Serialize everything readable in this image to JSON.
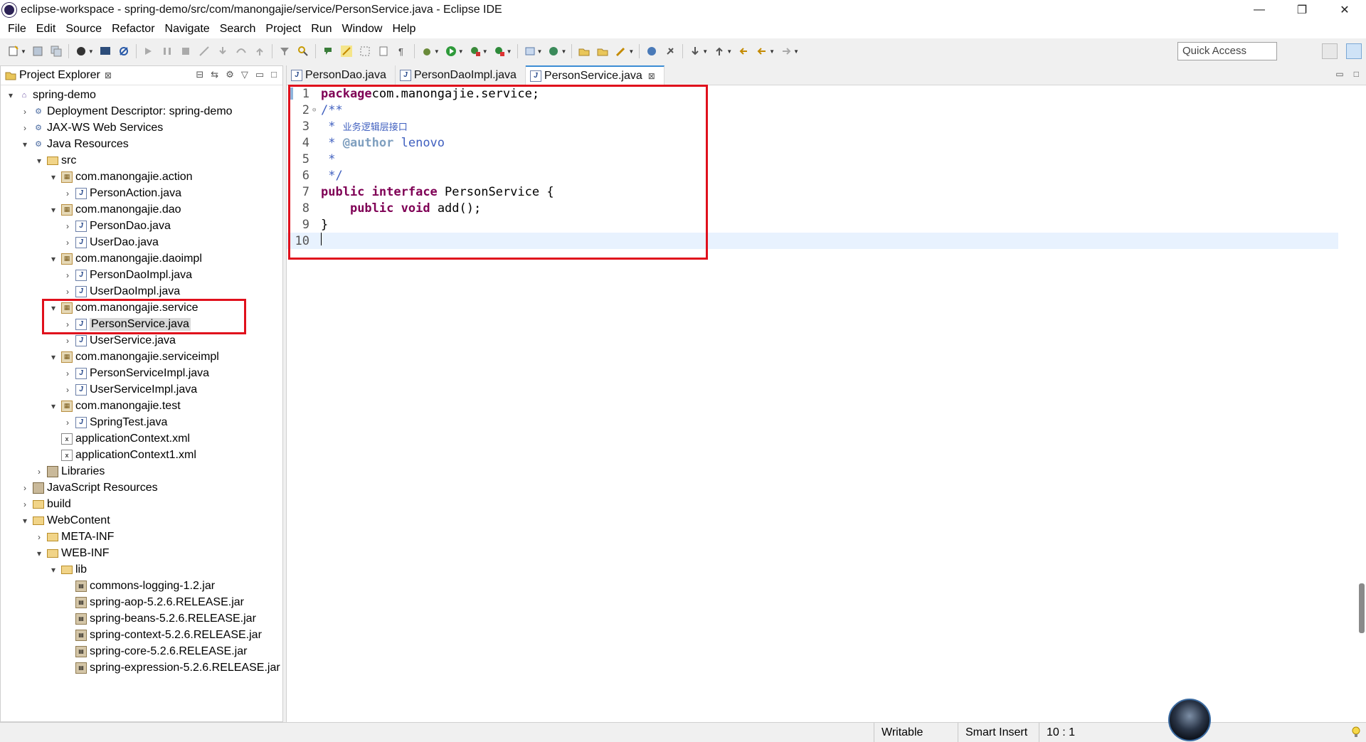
{
  "window": {
    "title": "eclipse-workspace - spring-demo/src/com/manongajie/service/PersonService.java - Eclipse IDE",
    "minimize": "—",
    "restore": "❐",
    "close": "✕"
  },
  "menu": [
    "File",
    "Edit",
    "Source",
    "Refactor",
    "Navigate",
    "Search",
    "Project",
    "Run",
    "Window",
    "Help"
  ],
  "toolbar": {
    "quick_access": "Quick Access"
  },
  "explorer": {
    "title": "Project Explorer",
    "close": "⊠",
    "tree": [
      {
        "label": "spring-demo",
        "depth": 0,
        "twisty": "▾",
        "icon": "project"
      },
      {
        "label": "Deployment Descriptor: spring-demo",
        "depth": 1,
        "twisty": "›",
        "icon": "gear"
      },
      {
        "label": "JAX-WS Web Services",
        "depth": 1,
        "twisty": "›",
        "icon": "gear"
      },
      {
        "label": "Java Resources",
        "depth": 1,
        "twisty": "▾",
        "icon": "gear"
      },
      {
        "label": "src",
        "depth": 2,
        "twisty": "▾",
        "icon": "folder"
      },
      {
        "label": "com.manongajie.action",
        "depth": 3,
        "twisty": "▾",
        "icon": "pkg"
      },
      {
        "label": "PersonAction.java",
        "depth": 4,
        "twisty": "›",
        "icon": "java"
      },
      {
        "label": "com.manongajie.dao",
        "depth": 3,
        "twisty": "▾",
        "icon": "pkg"
      },
      {
        "label": "PersonDao.java",
        "depth": 4,
        "twisty": "›",
        "icon": "java"
      },
      {
        "label": "UserDao.java",
        "depth": 4,
        "twisty": "›",
        "icon": "java"
      },
      {
        "label": "com.manongajie.daoimpl",
        "depth": 3,
        "twisty": "▾",
        "icon": "pkg"
      },
      {
        "label": "PersonDaoImpl.java",
        "depth": 4,
        "twisty": "›",
        "icon": "java"
      },
      {
        "label": "UserDaoImpl.java",
        "depth": 4,
        "twisty": "›",
        "icon": "java"
      },
      {
        "label": "com.manongajie.service",
        "depth": 3,
        "twisty": "▾",
        "icon": "pkg"
      },
      {
        "label": "PersonService.java",
        "depth": 4,
        "twisty": "›",
        "icon": "java",
        "selected": true
      },
      {
        "label": "UserService.java",
        "depth": 4,
        "twisty": "›",
        "icon": "java"
      },
      {
        "label": "com.manongajie.serviceimpl",
        "depth": 3,
        "twisty": "▾",
        "icon": "pkg"
      },
      {
        "label": "PersonServiceImpl.java",
        "depth": 4,
        "twisty": "›",
        "icon": "java"
      },
      {
        "label": "UserServiceImpl.java",
        "depth": 4,
        "twisty": "›",
        "icon": "java"
      },
      {
        "label": "com.manongajie.test",
        "depth": 3,
        "twisty": "▾",
        "icon": "pkg"
      },
      {
        "label": "SpringTest.java",
        "depth": 4,
        "twisty": "›",
        "icon": "java"
      },
      {
        "label": "applicationContext.xml",
        "depth": 3,
        "twisty": "",
        "icon": "xml"
      },
      {
        "label": "applicationContext1.xml",
        "depth": 3,
        "twisty": "",
        "icon": "xml"
      },
      {
        "label": "Libraries",
        "depth": 2,
        "twisty": "›",
        "icon": "lib"
      },
      {
        "label": "JavaScript Resources",
        "depth": 1,
        "twisty": "›",
        "icon": "lib"
      },
      {
        "label": "build",
        "depth": 1,
        "twisty": "›",
        "icon": "folder"
      },
      {
        "label": "WebContent",
        "depth": 1,
        "twisty": "▾",
        "icon": "folder"
      },
      {
        "label": "META-INF",
        "depth": 2,
        "twisty": "›",
        "icon": "folder"
      },
      {
        "label": "WEB-INF",
        "depth": 2,
        "twisty": "▾",
        "icon": "folder"
      },
      {
        "label": "lib",
        "depth": 3,
        "twisty": "▾",
        "icon": "folder"
      },
      {
        "label": "commons-logging-1.2.jar",
        "depth": 4,
        "twisty": "",
        "icon": "jar"
      },
      {
        "label": "spring-aop-5.2.6.RELEASE.jar",
        "depth": 4,
        "twisty": "",
        "icon": "jar"
      },
      {
        "label": "spring-beans-5.2.6.RELEASE.jar",
        "depth": 4,
        "twisty": "",
        "icon": "jar"
      },
      {
        "label": "spring-context-5.2.6.RELEASE.jar",
        "depth": 4,
        "twisty": "",
        "icon": "jar"
      },
      {
        "label": "spring-core-5.2.6.RELEASE.jar",
        "depth": 4,
        "twisty": "",
        "icon": "jar"
      },
      {
        "label": "spring-expression-5.2.6.RELEASE.jar",
        "depth": 4,
        "twisty": "",
        "icon": "jar"
      }
    ]
  },
  "editor": {
    "tabs": [
      {
        "label": "PersonDao.java",
        "active": false
      },
      {
        "label": "PersonDaoImpl.java",
        "active": false
      },
      {
        "label": "PersonService.java",
        "active": true
      }
    ],
    "tab_close": "⊠",
    "lines": [
      {
        "n": "1",
        "tokens": [
          [
            "kw",
            "package"
          ],
          [
            "",
            "com.manongajie.service;"
          ]
        ],
        "mark": true
      },
      {
        "n": "2",
        "fold": "⊖",
        "tokens": [
          [
            "cm",
            "/**"
          ]
        ]
      },
      {
        "n": "3",
        "tokens": [
          [
            "cm",
            " * "
          ],
          [
            "cm-cn",
            "业务逻辑层接口"
          ]
        ]
      },
      {
        "n": "4",
        "tokens": [
          [
            "cm",
            " * "
          ],
          [
            "tag",
            "@author"
          ],
          [
            "cm",
            " lenovo"
          ]
        ]
      },
      {
        "n": "5",
        "tokens": [
          [
            "cm",
            " *"
          ]
        ]
      },
      {
        "n": "6",
        "tokens": [
          [
            "cm",
            " */"
          ]
        ]
      },
      {
        "n": "7",
        "tokens": [
          [
            "kw",
            "public"
          ],
          [
            "",
            " "
          ],
          [
            "kw",
            "interface"
          ],
          [
            "",
            " PersonService {"
          ]
        ]
      },
      {
        "n": "8",
        "tokens": [
          [
            "",
            "    "
          ],
          [
            "kw",
            "public"
          ],
          [
            "",
            " "
          ],
          [
            "kw",
            "void"
          ],
          [
            "",
            " add();"
          ]
        ]
      },
      {
        "n": "9",
        "tokens": [
          [
            "",
            "}"
          ]
        ]
      },
      {
        "n": "10",
        "tokens": [],
        "current": true
      }
    ]
  },
  "status": {
    "mode": "Writable",
    "insert": "Smart Insert",
    "position": "10 : 1"
  },
  "colors": {
    "highlight": "#e0101c",
    "keyword": "#7f0055",
    "comment": "#3f5fbf"
  }
}
